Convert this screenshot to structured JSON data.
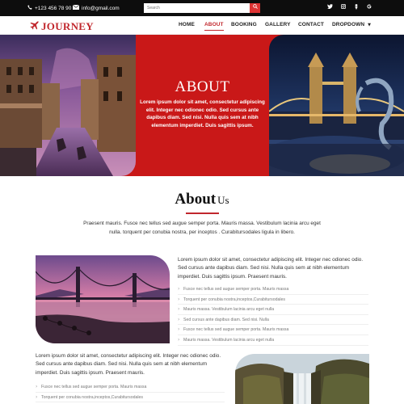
{
  "topbar": {
    "phone": "+123 456 78 90",
    "email": "info@gmail.com",
    "search_placeholder": "Search",
    "search_icon": "search-icon",
    "social_icons": [
      "twitter-icon",
      "instagram-icon",
      "youtube-icon",
      "google-icon"
    ]
  },
  "logo": {
    "text": "JOURNEY",
    "icon": "airplane-icon"
  },
  "nav": {
    "items": [
      "HOME",
      "ABOUT",
      "BOOKING",
      "GALLERY",
      "CONTACT",
      "DROPDOWN"
    ],
    "active": "ABOUT"
  },
  "hero": {
    "title": "ABOUT",
    "text": "Lorem ipsum dolor sit amet, consectetur adipiscing elit. Integer nec odionec odio. Sed cursus ante dapibus diam. Sed nisi. Nulla quis sem at nibh elementum imperdiet. Duis sagittis ipsum."
  },
  "about": {
    "title_big": "About",
    "title_small": "Us",
    "intro": "Praesent mauris. Fusce nec tellus sed augue semper porta. Mauris massa. Vestibulum lacinia arcu eget nulla. torquent per conubia nostra, per inceptos . Curabitursodales ligula in libero.",
    "block1": {
      "paragraph": "Lorem ipsum dolor sit amet, consectetur adipiscing elit. Integer nec odionec odio. Sed cursus ante dapibus diam. Sed nisi. Nulla quis sem at nibh elementum imperdiet. Duis sagittis ipsum. Praesent mauris.",
      "list": [
        "Fusce nec tellus sed augue semper porta. Mauris massa",
        "Torquent per conubia nostra,inceptos,Curabitursodales",
        "Mauris massa. Vestibulum lacinia arcu eget nulla",
        "Sed cursus ante dapibus diam. Sed nisi. Nulla",
        "Fusce nec tellus sed augue semper porta. Mauris massa",
        "Mauris massa. Vestibulum lacinia arcu eget nulla"
      ]
    },
    "block2": {
      "paragraph": "Lorem ipsum dolor sit amet, consectetur adipiscing elit. Integer nec odionec odio. Sed cursus ante dapibus diam. Sed nisi. Nulla quis sem at nibh elementum imperdiet. Duis sagittis ipsum. Praesent mauris.",
      "list": [
        "Fusce nec tellus sed augue semper porta. Mauris massa",
        "Torquent per conubia nostra,inceptos,Curabitursodales"
      ]
    }
  },
  "colors": {
    "accent": "#c1272d",
    "hero_bg": "#c91818",
    "topbar_bg": "#0d0d0d"
  }
}
